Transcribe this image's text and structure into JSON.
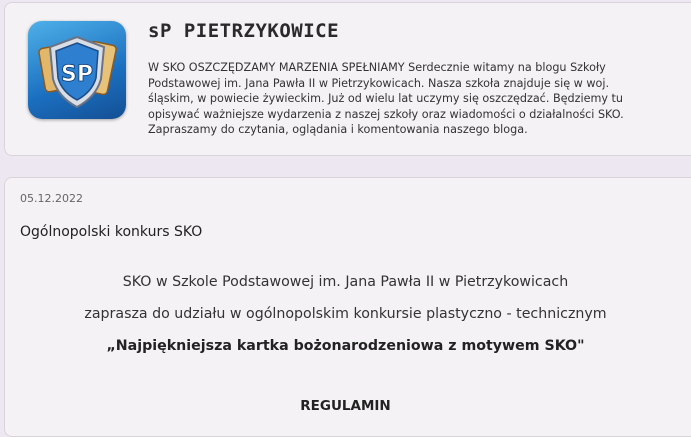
{
  "blog": {
    "title": "sP PIETRZYKOWICE",
    "logo_text": "SP",
    "description": "W SKO OSZCZĘDZAMY MARZENIA SPEŁNIAMY Serdecznie witamy na blogu Szkoły Podstawowej im. Jana Pawła II w Pietrzykowicach. Nasza szkoła znajduje się w woj. śląskim, w powiecie żywieckim. Już od wielu lat uczymy się oszczędzać. Będziemy tu opisywać ważniejsze wydarzenia z naszej szkoły oraz wiadomości o działalności SKO. Zapraszamy do czytania, oglądania i komentowania naszego bloga."
  },
  "post": {
    "date": "05.12.2022",
    "title": "Ogólnopolski konkurs SKO",
    "lines": [
      "SKO w Szkole Podstawowej im. Jana Pawła II w Pietrzykowicach",
      "zaprasza do udziału w ogólnopolskim konkursie plastyczno - technicznym",
      "„Najpiękniejsza kartka bożonarodzeniowa z motywem SKO\"",
      "REGULAMIN"
    ]
  },
  "colors": {
    "page_bg": "#ece7f0",
    "card_bg": "#f4f2f4",
    "logo_blue": "#1b6fc0"
  }
}
